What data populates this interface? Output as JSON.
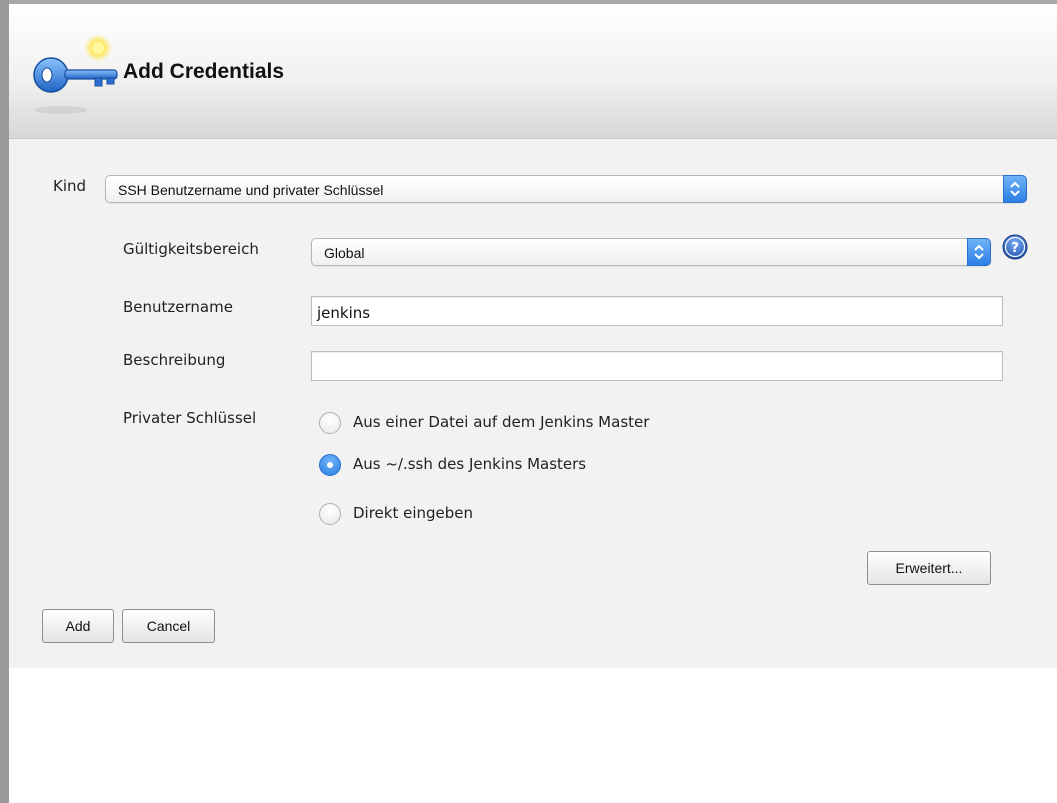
{
  "dialog": {
    "title": "Add Credentials",
    "icon": "key-icon"
  },
  "form": {
    "kind": {
      "label": "Kind",
      "selected": "SSH Benutzername und privater Schlüssel"
    },
    "scope": {
      "label": "Gültigkeitsbereich",
      "selected": "Global",
      "help_icon": "help-icon"
    },
    "username": {
      "label": "Benutzername",
      "value": "jenkins"
    },
    "description": {
      "label": "Beschreibung",
      "value": ""
    },
    "private_key": {
      "label": "Privater Schlüssel",
      "options": [
        {
          "label": "Aus einer Datei auf dem Jenkins Master",
          "checked": false
        },
        {
          "label": "Aus ~/.ssh des Jenkins Masters",
          "checked": true
        },
        {
          "label": "Direkt eingeben",
          "checked": false
        }
      ]
    },
    "advanced_label": "Erweitert..."
  },
  "buttons": {
    "add": "Add",
    "cancel": "Cancel"
  },
  "colors": {
    "accent": "#2d7fe6",
    "dialog_bg": "#f2f2f2"
  }
}
